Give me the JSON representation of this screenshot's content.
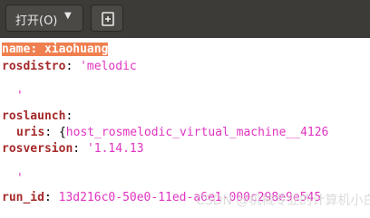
{
  "toolbar": {
    "open_label": "打开(O)",
    "open_icon": "chevron-down-icon",
    "new_tab_icon": "new-document-plus-icon"
  },
  "editor": {
    "lines": {
      "l1": {
        "key": "name",
        "sep": ": ",
        "value": "xiaohuang"
      },
      "l2": {
        "key": "rosdistro",
        "sep": ": ",
        "value": "'melodic"
      },
      "l3": {
        "value": "'"
      },
      "l4": {
        "key": "roslaunch",
        "sep": ":"
      },
      "l5": {
        "key": "uris",
        "sep": ": ",
        "brace": "{",
        "value": "host_rosmelodic_virtual_machine__4126"
      },
      "l6": {
        "key": "rosversion",
        "sep": ": ",
        "value": "'1.14.13"
      },
      "l7": {
        "value": "'"
      },
      "l8": {
        "key": "run_id",
        "sep": ": ",
        "value": "13d216c0-50e0-11ed-a6e1-000c298e9e545"
      }
    }
  },
  "watermark": "CSDN @机械专业的计算机小白"
}
